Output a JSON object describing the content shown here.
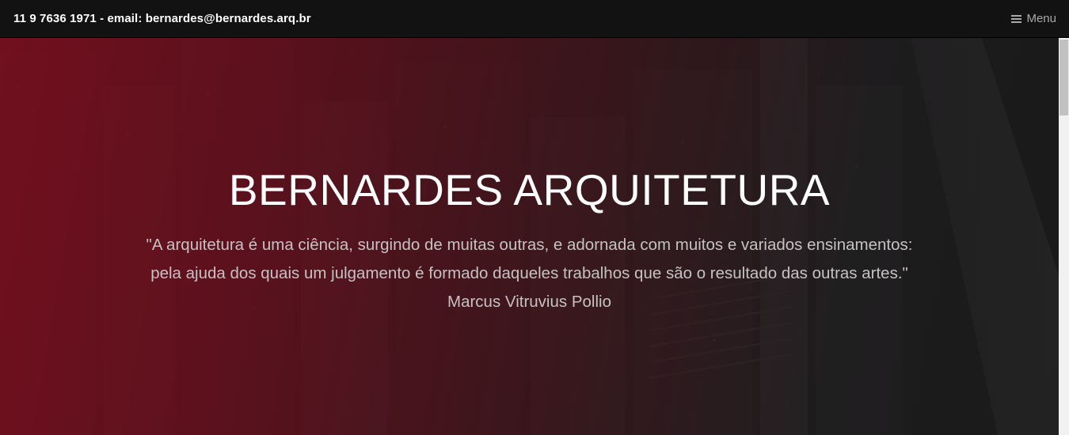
{
  "topbar": {
    "contact": "11 9 7636 1971 - email: bernardes@bernardes.arq.br",
    "menu_label": "Menu",
    "menu_icon": "hamburger-icon"
  },
  "hero": {
    "title": "BERNARDES ARQUITETURA",
    "quote_line_1": "\"A arquitetura é uma ciência, surgindo de muitas outras, e adornada com muitos e variados ensinamentos:",
    "quote_line_2": "pela ajuda dos quais um julgamento é formado daqueles trabalhos que são o resultado das outras artes.\"",
    "quote_author": "Marcus Vitruvius Pollio",
    "overlay_color": "#7a0e1e",
    "background": "aerial city photo"
  },
  "colors": {
    "topbar_bg": "#121212",
    "contact_text": "#ffffff",
    "menu_text": "#a9a9a9",
    "title_text": "#ffffff",
    "quote_text": "#c6c2c2"
  }
}
